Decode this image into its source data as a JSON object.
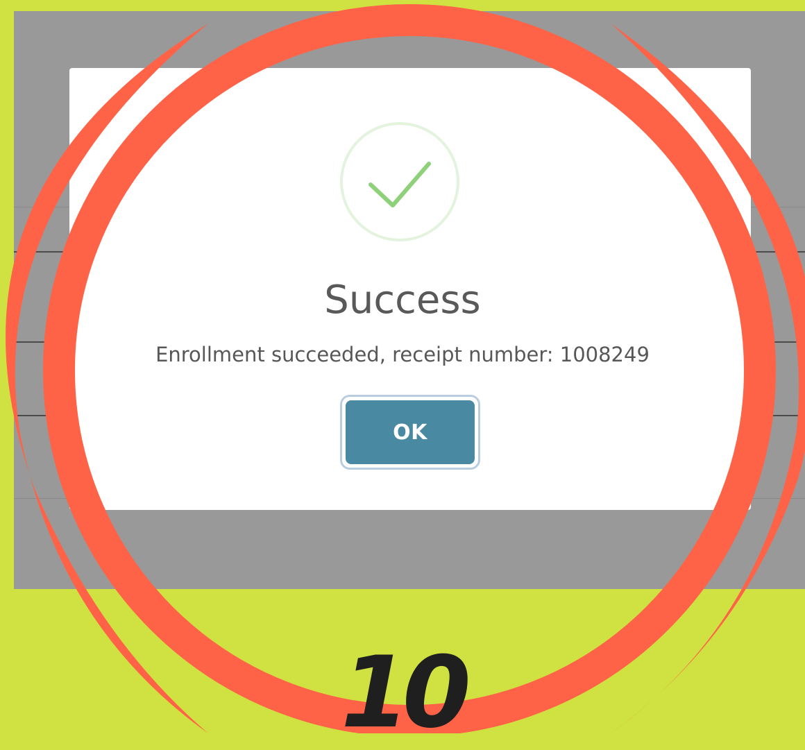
{
  "dialog": {
    "icon": "checkmark-circle-icon",
    "title": "Success",
    "message": "Enrollment succeeded, receipt number: 1008249",
    "ok_label": "OK"
  },
  "annotation": {
    "step_number": "10",
    "highlight_shape": "circle",
    "highlight_color": "#ff6347"
  },
  "colors": {
    "page_background": "#cfe241",
    "backdrop": "#999999",
    "success_green": "#8fd07a",
    "button_blue": "#4a89a2"
  }
}
